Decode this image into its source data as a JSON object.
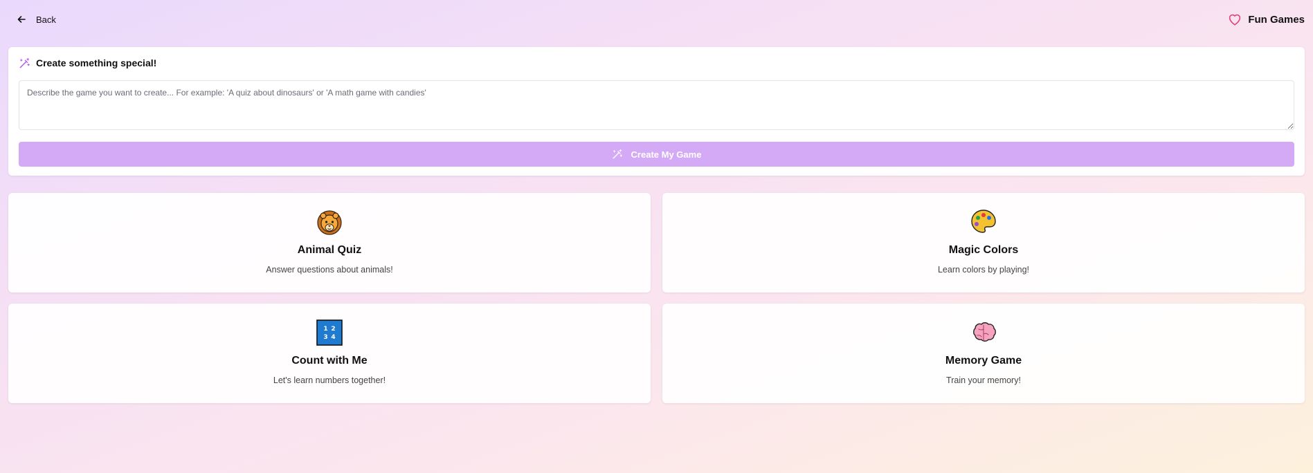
{
  "header": {
    "back_label": "Back",
    "brand_title": "Fun Games",
    "back_icon": "arrow-left-icon",
    "brand_icon": "heart-icon"
  },
  "create": {
    "title": "Create something special!",
    "title_icon": "magic-wand-icon",
    "placeholder": "Describe the game you want to create... For example: 'A quiz about dinosaurs' or 'A math game with candies'",
    "value": "",
    "button_label": "Create My Game",
    "button_icon": "magic-wand-icon"
  },
  "games": [
    {
      "title": "Animal Quiz",
      "description": "Answer questions about animals!",
      "icon": "lion-face-icon"
    },
    {
      "title": "Magic Colors",
      "description": "Learn colors by playing!",
      "icon": "artist-palette-icon"
    },
    {
      "title": "Count with Me",
      "description": "Let's learn numbers together!",
      "icon": "input-numbers-icon",
      "icon_text": [
        "1",
        "2",
        "3",
        "4"
      ]
    },
    {
      "title": "Memory Game",
      "description": "Train your memory!",
      "icon": "brain-icon"
    }
  ],
  "colors": {
    "accent": "#d4a9f6",
    "heart": "#e0457b",
    "wand": "#b45be8"
  }
}
